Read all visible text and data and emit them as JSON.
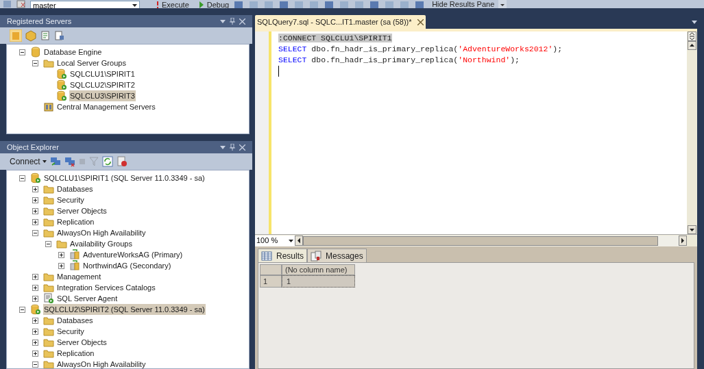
{
  "toolbar": {
    "database": "master",
    "execute": "Execute",
    "debug": "Debug",
    "hide_results": "Hide Results Pane"
  },
  "registered_servers": {
    "title": "Registered Servers",
    "tree": [
      {
        "label": "Database Engine",
        "kind": "engine",
        "expanded": true,
        "selected": false,
        "children": [
          {
            "label": "Local Server Groups",
            "kind": "folder",
            "expanded": true,
            "selected": false,
            "children": [
              {
                "label": "SQLCLU1\\SPIRIT1",
                "kind": "server",
                "selected": false
              },
              {
                "label": "SQLCLU2\\SPIRIT2",
                "kind": "server",
                "selected": false
              },
              {
                "label": "SQLCLU3\\SPIRIT3",
                "kind": "server",
                "selected": true
              }
            ]
          },
          {
            "label": "Central Management Servers",
            "kind": "cms",
            "selected": false
          }
        ]
      }
    ]
  },
  "object_explorer": {
    "title": "Object Explorer",
    "connect": "Connect",
    "tree": [
      {
        "label": "SQLCLU1\\SPIRIT1 (SQL Server 11.0.3349 - sa)",
        "kind": "server",
        "expanded": true,
        "selected": false,
        "children": [
          {
            "label": "Databases",
            "kind": "folder",
            "expanded": false,
            "selected": false
          },
          {
            "label": "Security",
            "kind": "folder",
            "expanded": false,
            "selected": false
          },
          {
            "label": "Server Objects",
            "kind": "folder",
            "expanded": false,
            "selected": false
          },
          {
            "label": "Replication",
            "kind": "folder",
            "expanded": false,
            "selected": false
          },
          {
            "label": "AlwaysOn High Availability",
            "kind": "folder",
            "expanded": true,
            "selected": false,
            "children": [
              {
                "label": "Availability Groups",
                "kind": "folder",
                "expanded": true,
                "selected": false,
                "children": [
                  {
                    "label": "AdventureWorksAG (Primary)",
                    "kind": "ag",
                    "expanded": false,
                    "selected": false
                  },
                  {
                    "label": "NorthwindAG (Secondary)",
                    "kind": "ag",
                    "expanded": false,
                    "selected": false
                  }
                ]
              }
            ]
          },
          {
            "label": "Management",
            "kind": "folder",
            "expanded": false,
            "selected": false
          },
          {
            "label": "Integration Services Catalogs",
            "kind": "folder",
            "expanded": false,
            "selected": false
          },
          {
            "label": "SQL Server Agent",
            "kind": "agent",
            "expanded": false,
            "selected": false
          }
        ]
      },
      {
        "label": "SQLCLU2\\SPIRIT2 (SQL Server 11.0.3349 - sa)",
        "kind": "server",
        "expanded": true,
        "selected": true,
        "children": [
          {
            "label": "Databases",
            "kind": "folder",
            "expanded": false,
            "selected": false
          },
          {
            "label": "Security",
            "kind": "folder",
            "expanded": false,
            "selected": false
          },
          {
            "label": "Server Objects",
            "kind": "folder",
            "expanded": false,
            "selected": false
          },
          {
            "label": "Replication",
            "kind": "folder",
            "expanded": false,
            "selected": false
          },
          {
            "label": "AlwaysOn High Availability",
            "kind": "folder",
            "expanded": true,
            "selected": false
          }
        ]
      }
    ]
  },
  "editor": {
    "tab_title": "SQLQuery7.sql - SQLC...IT1.master (sa (58))*",
    "lines": [
      {
        "selected": true,
        "tokens": [
          {
            "kind": "plain",
            "text": ":CONNECT SQLCLU1\\SPIRIT1"
          }
        ]
      },
      {
        "selected": false,
        "tokens": [
          {
            "kind": "keyword",
            "text": "SELECT"
          },
          {
            "kind": "plain",
            "text": " dbo.fn_hadr_is_primary_replica("
          },
          {
            "kind": "string",
            "text": "'AdventureWorks2012'"
          },
          {
            "kind": "plain",
            "text": ");"
          }
        ]
      },
      {
        "selected": false,
        "tokens": [
          {
            "kind": "keyword",
            "text": "SELECT"
          },
          {
            "kind": "plain",
            "text": " dbo.fn_hadr_is_primary_replica("
          },
          {
            "kind": "string",
            "text": "'Northwind'"
          },
          {
            "kind": "plain",
            "text": ");"
          }
        ]
      }
    ],
    "zoom": "100 %"
  },
  "results": {
    "tabs": [
      {
        "label": "Results",
        "kind": "grid",
        "selected": true
      },
      {
        "label": "Messages",
        "kind": "messages",
        "selected": false
      }
    ],
    "columns": [
      "(No column name)"
    ],
    "rows": [
      {
        "number": "1",
        "cells": [
          "1"
        ]
      }
    ]
  }
}
